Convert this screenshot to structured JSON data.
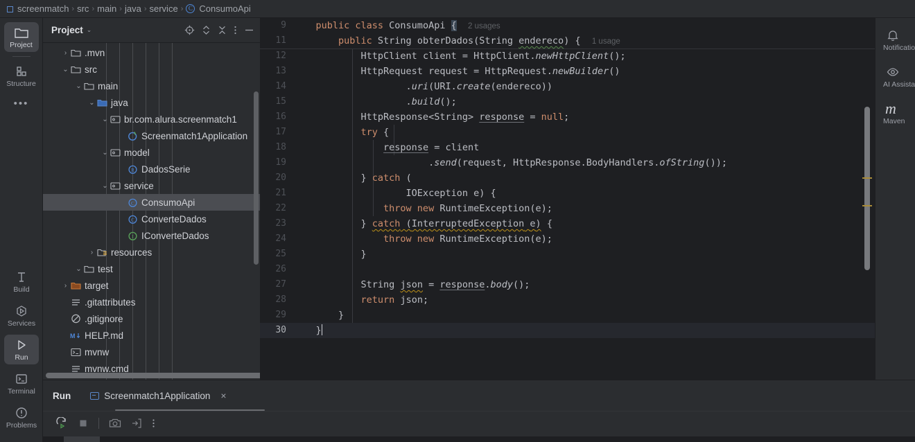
{
  "breadcrumb": {
    "items": [
      {
        "label": "screenmatch",
        "icon": "module-icon"
      },
      {
        "label": "src",
        "icon": null
      },
      {
        "label": "main",
        "icon": null
      },
      {
        "label": "java",
        "icon": null
      },
      {
        "label": "service",
        "icon": null
      },
      {
        "label": "ConsumoApi",
        "icon": "class-icon"
      }
    ],
    "separator": "›"
  },
  "left_rail": {
    "top": [
      {
        "label": "Project",
        "icon": "folder-icon",
        "active": true
      },
      {
        "label": "Structure",
        "icon": "structure-icon",
        "active": false
      }
    ],
    "more": "•••",
    "bottom": [
      {
        "label": "Build",
        "icon": "hammer-icon",
        "active": false
      },
      {
        "label": "Services",
        "icon": "services-icon",
        "active": false
      },
      {
        "label": "Run",
        "icon": "play-icon",
        "active": true
      },
      {
        "label": "Terminal",
        "icon": "terminal-icon",
        "active": false
      },
      {
        "label": "Problems",
        "icon": "problems-icon",
        "active": false
      }
    ]
  },
  "right_rail": {
    "items": [
      {
        "label": "Notifications",
        "icon": "bell-icon"
      },
      {
        "label": "AI Assistant",
        "icon": "ai-eye-icon"
      },
      {
        "label": "Maven",
        "icon": "maven-icon"
      }
    ]
  },
  "project_panel": {
    "title": "Project",
    "chevron": "⌄",
    "actions": [
      {
        "name": "locate-file",
        "icon": "crosshair-icon"
      },
      {
        "name": "expand-collapse",
        "icon": "chevron-updown-icon"
      },
      {
        "name": "collapse-all",
        "icon": "collapse-all-icon"
      },
      {
        "name": "options",
        "icon": "more-vertical-icon"
      },
      {
        "name": "hide",
        "icon": "minimize-icon"
      }
    ],
    "tree": [
      {
        "label": ".mvn",
        "indent": 1,
        "arrow": "›",
        "icon": "folder-icon",
        "selected": false
      },
      {
        "label": "src",
        "indent": 1,
        "arrow": "⌄",
        "icon": "folder-icon",
        "selected": false
      },
      {
        "label": "main",
        "indent": 2,
        "arrow": "⌄",
        "icon": "folder-icon",
        "selected": false
      },
      {
        "label": "java",
        "indent": 3,
        "arrow": "⌄",
        "icon": "source-root-icon",
        "selected": false
      },
      {
        "label": "br.com.alura.screenmatch1",
        "indent": 4,
        "arrow": "⌄",
        "icon": "package-icon",
        "selected": false
      },
      {
        "label": "Screenmatch1Application",
        "indent": 5,
        "arrow": "",
        "icon": "spring-icon",
        "selected": false
      },
      {
        "label": "model",
        "indent": 4,
        "arrow": "⌄",
        "icon": "package-icon",
        "selected": false
      },
      {
        "label": "DadosSerie",
        "indent": 5,
        "arrow": "",
        "icon": "record-icon",
        "selected": false
      },
      {
        "label": "service",
        "indent": 4,
        "arrow": "⌄",
        "icon": "package-icon",
        "selected": false
      },
      {
        "label": "ConsumoApi",
        "indent": 5,
        "arrow": "",
        "icon": "class-icon",
        "selected": true
      },
      {
        "label": "ConverteDados",
        "indent": 5,
        "arrow": "",
        "icon": "class-icon",
        "selected": false
      },
      {
        "label": "IConverteDados",
        "indent": 5,
        "arrow": "",
        "icon": "interface-icon",
        "selected": false
      },
      {
        "label": "resources",
        "indent": 3,
        "arrow": "›",
        "icon": "resources-icon",
        "selected": false
      },
      {
        "label": "test",
        "indent": 2,
        "arrow": "⌄",
        "icon": "folder-icon",
        "selected": false
      },
      {
        "label": "target",
        "indent": 1,
        "arrow": "›",
        "icon": "target-icon",
        "selected": false
      },
      {
        "label": ".gitattributes",
        "indent": 1,
        "arrow": "",
        "icon": "text-file-icon",
        "selected": false
      },
      {
        "label": ".gitignore",
        "indent": 1,
        "arrow": "",
        "icon": "gitignore-icon",
        "selected": false
      },
      {
        "label": "HELP.md",
        "indent": 1,
        "arrow": "",
        "icon": "markdown-icon",
        "selected": false
      },
      {
        "label": "mvnw",
        "indent": 1,
        "arrow": "",
        "icon": "shell-icon",
        "selected": false
      },
      {
        "label": "mvnw.cmd",
        "indent": 1,
        "arrow": "",
        "icon": "text-file-icon",
        "selected": false
      }
    ]
  },
  "editor": {
    "sticky_lines": [
      9,
      11
    ],
    "current_line": 30,
    "usage_hints": {
      "line9": "2 usages",
      "line11": "1 usage"
    },
    "error_badge": "!",
    "lines": [
      {
        "n": 9,
        "text": "    public class ConsumoApi {  2 usages"
      },
      {
        "n": 11,
        "text": "        public String obterDados(String endereco) {  1 usage"
      },
      {
        "n": 12,
        "text": "            HttpClient client = HttpClient.newHttpClient();"
      },
      {
        "n": 13,
        "text": "            HttpRequest request = HttpRequest.newBuilder()"
      },
      {
        "n": 14,
        "text": "                    .uri(URI.create(endereco))"
      },
      {
        "n": 15,
        "text": "                    .build();"
      },
      {
        "n": 16,
        "text": "            HttpResponse<String> response = null;"
      },
      {
        "n": 17,
        "text": "            try {"
      },
      {
        "n": 18,
        "text": "                response = client"
      },
      {
        "n": 19,
        "text": "                        .send(request, HttpResponse.BodyHandlers.ofString());"
      },
      {
        "n": 20,
        "text": "            } catch ("
      },
      {
        "n": 21,
        "text": "                    IOException e) {"
      },
      {
        "n": 22,
        "text": "                throw new RuntimeException(e);"
      },
      {
        "n": 23,
        "text": "            } catch (InterruptedException e) {"
      },
      {
        "n": 24,
        "text": "                throw new RuntimeException(e);"
      },
      {
        "n": 25,
        "text": "            }"
      },
      {
        "n": 26,
        "text": ""
      },
      {
        "n": 27,
        "text": "            String json = response.body();"
      },
      {
        "n": 28,
        "text": "            return json;"
      },
      {
        "n": 29,
        "text": "        }"
      },
      {
        "n": 30,
        "text": "    }"
      }
    ]
  },
  "run_window": {
    "title": "Run",
    "tab_label": "Screenmatch1Application",
    "close": "×",
    "toolbar": [
      {
        "name": "rerun-button",
        "icon": "rerun-icon"
      },
      {
        "name": "stop-button",
        "icon": "stop-icon"
      },
      {
        "name": "screenshot-button",
        "icon": "camera-icon"
      },
      {
        "name": "export-button",
        "icon": "export-icon"
      },
      {
        "name": "more-button",
        "icon": "more-vertical-icon"
      }
    ]
  },
  "colors": {
    "bg": "#1E1F22",
    "panel": "#2B2D30",
    "keyword": "#CF8E6D",
    "text": "#BCBEC4",
    "number": "#2AACB8",
    "error": "#DB5C5C",
    "warning": "#BE9117",
    "selection": "#4B4D52",
    "accent": "#4E86D6"
  }
}
